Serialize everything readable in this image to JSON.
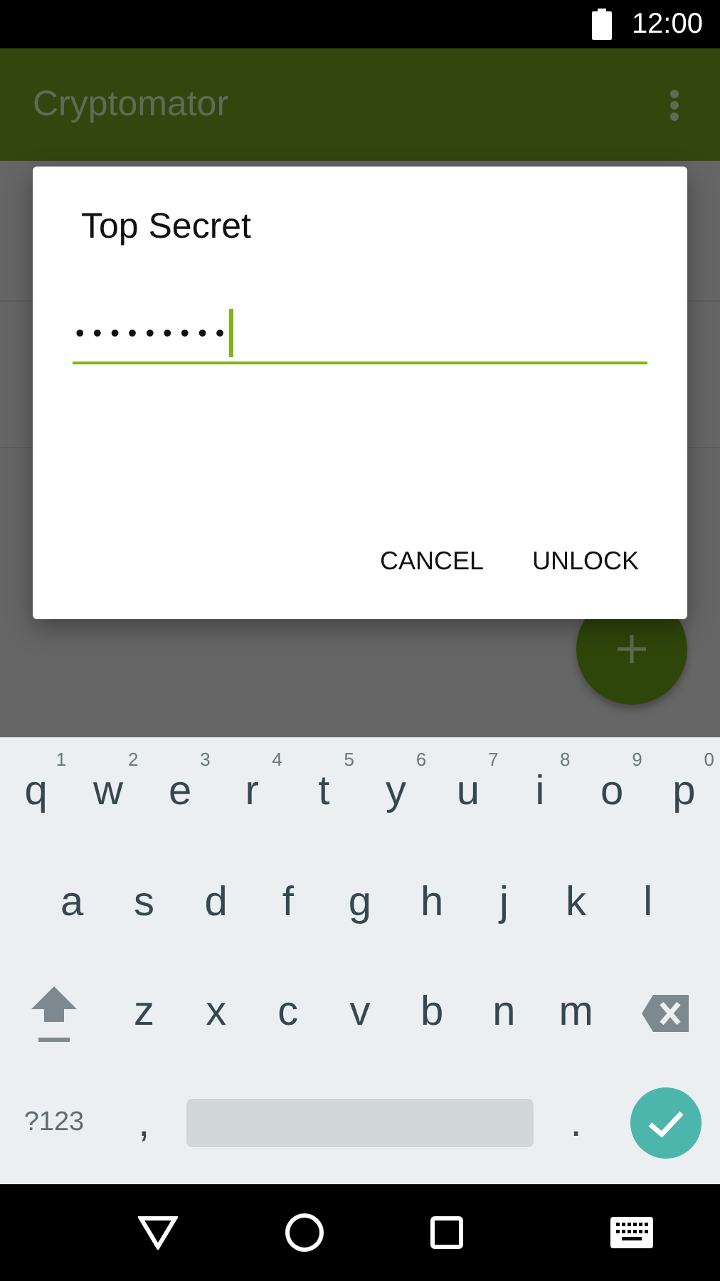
{
  "status_bar": {
    "time": "12:00"
  },
  "app_bar": {
    "title": "Cryptomator"
  },
  "dialog": {
    "title": "Top Secret",
    "password": {
      "value": "•••••••••",
      "focused": true
    },
    "buttons": [
      {
        "label": "CANCEL"
      },
      {
        "label": "UNLOCK"
      }
    ]
  },
  "keyboard": {
    "letter_rows": [
      {
        "keys": [
          {
            "kind": "letter",
            "label": "q",
            "hint": "1"
          },
          {
            "kind": "letter",
            "label": "w",
            "hint": "2"
          },
          {
            "kind": "letter",
            "label": "e",
            "hint": "3"
          },
          {
            "kind": "letter",
            "label": "r",
            "hint": "4"
          },
          {
            "kind": "letter",
            "label": "t",
            "hint": "5"
          },
          {
            "kind": "letter",
            "label": "y",
            "hint": "6"
          },
          {
            "kind": "letter",
            "label": "u",
            "hint": "7"
          },
          {
            "kind": "letter",
            "label": "i",
            "hint": "8"
          },
          {
            "kind": "letter",
            "label": "o",
            "hint": "9"
          },
          {
            "kind": "letter",
            "label": "p",
            "hint": "0"
          }
        ]
      },
      {
        "keys": [
          {
            "kind": "letter",
            "label": "a"
          },
          {
            "kind": "letter",
            "label": "s"
          },
          {
            "kind": "letter",
            "label": "d"
          },
          {
            "kind": "letter",
            "label": "f"
          },
          {
            "kind": "letter",
            "label": "g"
          },
          {
            "kind": "letter",
            "label": "h"
          },
          {
            "kind": "letter",
            "label": "j"
          },
          {
            "kind": "letter",
            "label": "k"
          },
          {
            "kind": "letter",
            "label": "l"
          }
        ]
      },
      {
        "keys": [
          {
            "kind": "shift"
          },
          {
            "kind": "letter",
            "label": "z"
          },
          {
            "kind": "letter",
            "label": "x"
          },
          {
            "kind": "letter",
            "label": "c"
          },
          {
            "kind": "letter",
            "label": "v"
          },
          {
            "kind": "letter",
            "label": "b"
          },
          {
            "kind": "letter",
            "label": "n"
          },
          {
            "kind": "letter",
            "label": "m"
          },
          {
            "kind": "backspace"
          }
        ]
      }
    ],
    "bottom_row": [
      {
        "kind": "symbols",
        "label": "?123"
      },
      {
        "kind": "letter",
        "label": ","
      },
      {
        "kind": "space"
      },
      {
        "kind": "letter",
        "label": "."
      },
      {
        "kind": "enter"
      }
    ]
  }
}
